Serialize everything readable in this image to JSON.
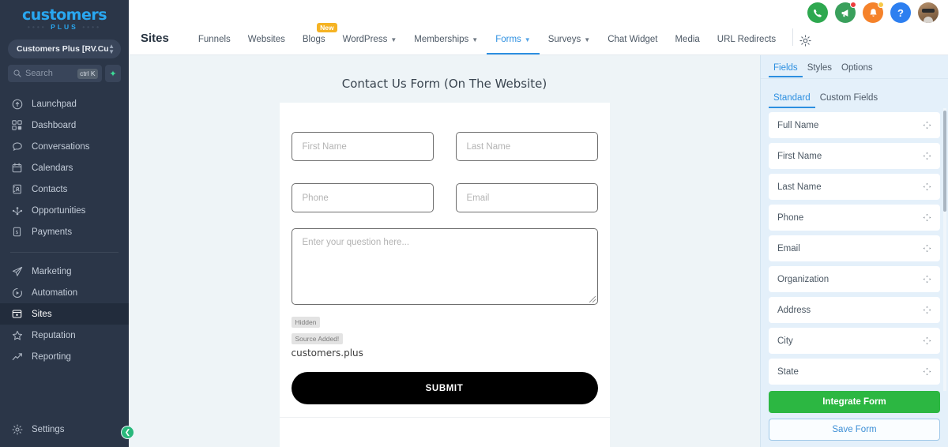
{
  "sidebar": {
    "logo_line1": "customers",
    "logo_line2": "PLUS",
    "account": {
      "name": "Customers Plus [RV.Cust...",
      "icon": "chevron-updown-icon"
    },
    "search": {
      "placeholder": "Search",
      "shortcut": "ctrl K",
      "spark_icon": "spark-icon"
    },
    "items": [
      {
        "label": "Launchpad",
        "icon": "rocket-icon",
        "active": false
      },
      {
        "label": "Dashboard",
        "icon": "grid-icon",
        "active": false
      },
      {
        "label": "Conversations",
        "icon": "chat-bubble-icon",
        "active": false
      },
      {
        "label": "Calendars",
        "icon": "calendar-icon",
        "active": false
      },
      {
        "label": "Contacts",
        "icon": "contact-book-icon",
        "active": false
      },
      {
        "label": "Opportunities",
        "icon": "opportunities-icon",
        "active": false
      },
      {
        "label": "Payments",
        "icon": "payments-icon",
        "active": false
      }
    ],
    "items2": [
      {
        "label": "Marketing",
        "icon": "paper-plane-icon",
        "active": false
      },
      {
        "label": "Automation",
        "icon": "play-circle-icon",
        "active": false
      },
      {
        "label": "Sites",
        "icon": "sites-icon",
        "active": true
      },
      {
        "label": "Reputation",
        "icon": "star-icon",
        "active": false
      },
      {
        "label": "Reporting",
        "icon": "trending-up-icon",
        "active": false
      }
    ],
    "settings": {
      "label": "Settings",
      "icon": "gear-icon"
    },
    "collapse": {
      "icon": "chevron-left-icon"
    }
  },
  "topbar": {
    "title": "Sites",
    "tabs": [
      {
        "label": "Funnels",
        "caret": false,
        "active": false,
        "badge": null
      },
      {
        "label": "Websites",
        "caret": false,
        "active": false,
        "badge": null
      },
      {
        "label": "Blogs",
        "caret": false,
        "active": false,
        "badge": "New"
      },
      {
        "label": "WordPress",
        "caret": true,
        "active": false,
        "badge": null
      },
      {
        "label": "Memberships",
        "caret": true,
        "active": false,
        "badge": null
      },
      {
        "label": "Forms",
        "caret": true,
        "active": true,
        "badge": null
      },
      {
        "label": "Surveys",
        "caret": true,
        "active": false,
        "badge": null
      },
      {
        "label": "Chat Widget",
        "caret": false,
        "active": false,
        "badge": null
      },
      {
        "label": "Media",
        "caret": false,
        "active": false,
        "badge": null
      },
      {
        "label": "URL Redirects",
        "caret": false,
        "active": false,
        "badge": null
      }
    ],
    "gear": {
      "icon": "gear-icon"
    },
    "icons": [
      {
        "name": "phone-icon",
        "glyph": "✆",
        "color": "#2ea84f",
        "badge": null
      },
      {
        "name": "megaphone-icon",
        "glyph": "◤",
        "color": "#3aa05c",
        "badge": "red"
      },
      {
        "name": "bell-icon",
        "glyph": "ὑ4",
        "color": "#f5822a",
        "badge": "yellow"
      },
      {
        "name": "help-icon",
        "glyph": "?",
        "color": "#2d7ff0",
        "badge": null
      },
      {
        "name": "avatar",
        "glyph": "",
        "color": "",
        "badge": null
      }
    ]
  },
  "form": {
    "title": "Contact Us Form (On The Website)",
    "faint_line": "",
    "fields": {
      "first_name": "First Name",
      "last_name": "Last Name",
      "phone": "Phone",
      "email": "Email",
      "question": "Enter your question here..."
    },
    "hidden_label": "Hidden",
    "source_label": "Source Added!",
    "source_value": "customers.plus",
    "submit_label": "SUBMIT"
  },
  "right_panel": {
    "tabs": [
      {
        "label": "Fields",
        "active": true
      },
      {
        "label": "Styles",
        "active": false
      },
      {
        "label": "Options",
        "active": false
      }
    ],
    "subtabs": [
      {
        "label": "Standard",
        "active": true
      },
      {
        "label": "Custom Fields",
        "active": false
      }
    ],
    "fields": [
      {
        "label": "Full Name",
        "icon": "move-icon"
      },
      {
        "label": "First Name",
        "icon": "move-icon"
      },
      {
        "label": "Last Name",
        "icon": "move-icon"
      },
      {
        "label": "Phone",
        "icon": "move-icon"
      },
      {
        "label": "Email",
        "icon": "move-icon"
      },
      {
        "label": "Organization",
        "icon": "move-icon"
      },
      {
        "label": "Address",
        "icon": "move-icon"
      },
      {
        "label": "City",
        "icon": "move-icon"
      },
      {
        "label": "State",
        "icon": "move-icon"
      }
    ],
    "integrate_label": "Integrate Form",
    "save_label": "Save Form"
  },
  "colors": {
    "sidebar_bg": "#2b3648",
    "accent_blue": "#2d8fe0",
    "brand_blue": "#29a7f0",
    "green": "#2cb742",
    "badge_amber": "#f5b324",
    "panel_bg": "#e4f0fa"
  }
}
